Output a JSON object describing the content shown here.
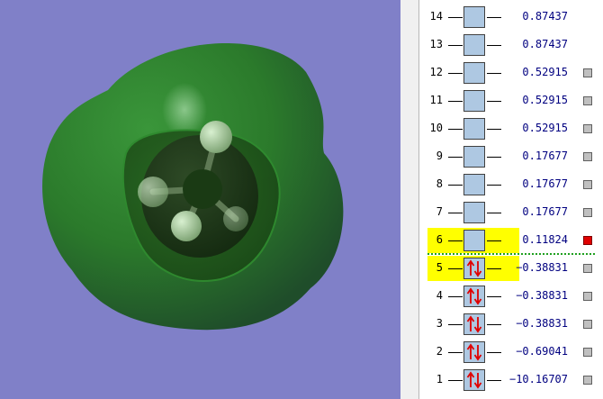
{
  "viewport": {
    "background_color": "#8080c8",
    "isosurface_color": "#2e7d2e",
    "atoms": [
      "carbon",
      "hydrogen",
      "hydrogen",
      "hydrogen",
      "hydrogen"
    ]
  },
  "orbitals": [
    {
      "number": "14",
      "energy": "0.87437",
      "occupied": false,
      "highlighted": false,
      "checkbox": false,
      "checked": false
    },
    {
      "number": "13",
      "energy": "0.87437",
      "occupied": false,
      "highlighted": false,
      "checkbox": false,
      "checked": false
    },
    {
      "number": "12",
      "energy": "0.52915",
      "occupied": false,
      "highlighted": false,
      "checkbox": true,
      "checked": false
    },
    {
      "number": "11",
      "energy": "0.52915",
      "occupied": false,
      "highlighted": false,
      "checkbox": true,
      "checked": false
    },
    {
      "number": "10",
      "energy": "0.52915",
      "occupied": false,
      "highlighted": false,
      "checkbox": true,
      "checked": false
    },
    {
      "number": "9",
      "energy": "0.17677",
      "occupied": false,
      "highlighted": false,
      "checkbox": true,
      "checked": false
    },
    {
      "number": "8",
      "energy": "0.17677",
      "occupied": false,
      "highlighted": false,
      "checkbox": true,
      "checked": false
    },
    {
      "number": "7",
      "energy": "0.17677",
      "occupied": false,
      "highlighted": false,
      "checkbox": true,
      "checked": false
    },
    {
      "number": "6",
      "energy": "0.11824",
      "occupied": false,
      "highlighted": true,
      "checkbox": true,
      "checked": true
    },
    {
      "number": "5",
      "energy": "−0.38831",
      "occupied": true,
      "highlighted": true,
      "checkbox": true,
      "checked": false
    },
    {
      "number": "4",
      "energy": "−0.38831",
      "occupied": true,
      "highlighted": false,
      "checkbox": true,
      "checked": false
    },
    {
      "number": "3",
      "energy": "−0.38831",
      "occupied": true,
      "highlighted": false,
      "checkbox": true,
      "checked": false
    },
    {
      "number": "2",
      "energy": "−0.69041",
      "occupied": true,
      "highlighted": false,
      "checkbox": true,
      "checked": false
    },
    {
      "number": "1",
      "energy": "−10.16707",
      "occupied": true,
      "highlighted": false,
      "checkbox": true,
      "checked": false
    }
  ],
  "colors": {
    "highlight": "#ffff00",
    "orbital_box": "#aec8e2",
    "energy_text": "#000080",
    "electron_arrow": "#e00000",
    "checkbox_checked": "#e00000",
    "checkbox_unchecked": "#c0c0c0",
    "gap_line": "#20a020"
  }
}
